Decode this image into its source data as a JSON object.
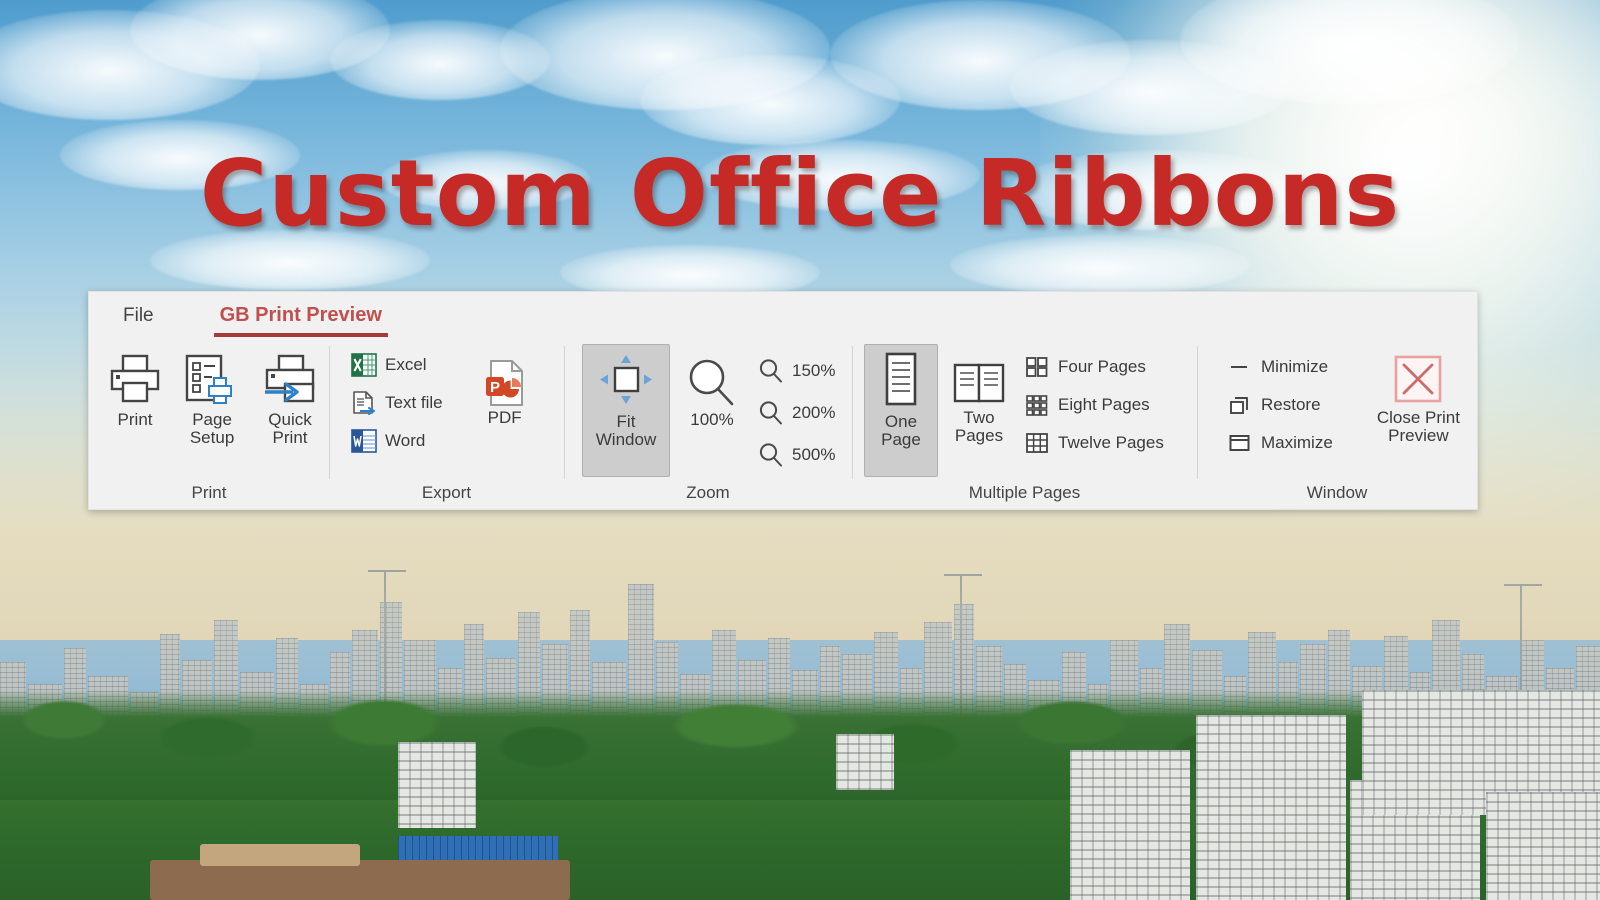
{
  "page": {
    "title": "Custom Office Ribbons",
    "title_color": "#C62A26"
  },
  "ribbon": {
    "tabs": [
      {
        "label": "File",
        "active": false
      },
      {
        "label": "GB Print Preview",
        "active": true
      }
    ],
    "accent_color": "#C0504D",
    "underline_color": "#A53B38",
    "groups": [
      {
        "label": "Print",
        "big_buttons": [
          {
            "label": "Print",
            "icon": "printer-icon",
            "selected": false
          },
          {
            "label": "Page\nSetup",
            "line1": "Page",
            "line2": "Setup",
            "icon": "page-setup-icon",
            "selected": false
          },
          {
            "label": "Quick\nPrint",
            "line1": "Quick",
            "line2": "Print",
            "icon": "quick-print-icon",
            "selected": false
          }
        ]
      },
      {
        "label": "Export",
        "small_buttons": [
          {
            "label": "Excel",
            "icon": "excel-icon"
          },
          {
            "label": "Text file",
            "icon": "text-file-icon"
          },
          {
            "label": "Word",
            "icon": "word-icon"
          }
        ],
        "big_buttons": [
          {
            "label": "PDF",
            "icon": "pdf-icon",
            "selected": false
          }
        ]
      },
      {
        "label": "Zoom",
        "big_buttons": [
          {
            "line1": "Fit",
            "line2": "Window",
            "icon": "fit-window-icon",
            "selected": true
          },
          {
            "line1": "100%",
            "line2": "",
            "icon": "magnifier-icon",
            "selected": false
          }
        ],
        "small_buttons": [
          {
            "label": "150%",
            "icon": "magnifier-icon"
          },
          {
            "label": "200%",
            "icon": "magnifier-icon"
          },
          {
            "label": "500%",
            "icon": "magnifier-icon"
          }
        ]
      },
      {
        "label": "Multiple Pages",
        "big_buttons": [
          {
            "line1": "One",
            "line2": "Page",
            "icon": "one-page-icon",
            "selected": true
          },
          {
            "line1": "Two",
            "line2": "Pages",
            "icon": "two-pages-icon",
            "selected": false
          }
        ],
        "small_buttons": [
          {
            "label": "Four Pages",
            "icon": "four-pages-icon"
          },
          {
            "label": "Eight Pages",
            "icon": "eight-pages-icon"
          },
          {
            "label": "Twelve Pages",
            "icon": "twelve-pages-icon"
          }
        ]
      },
      {
        "label": "Window",
        "small_buttons": [
          {
            "label": "Minimize",
            "icon": "minimize-icon"
          },
          {
            "label": "Restore",
            "icon": "restore-icon"
          },
          {
            "label": "Maximize",
            "icon": "maximize-icon"
          }
        ],
        "big_buttons": [
          {
            "line1": "Close Print",
            "line2": "Preview",
            "icon": "close-print-preview-icon",
            "selected": false
          }
        ]
      }
    ]
  }
}
